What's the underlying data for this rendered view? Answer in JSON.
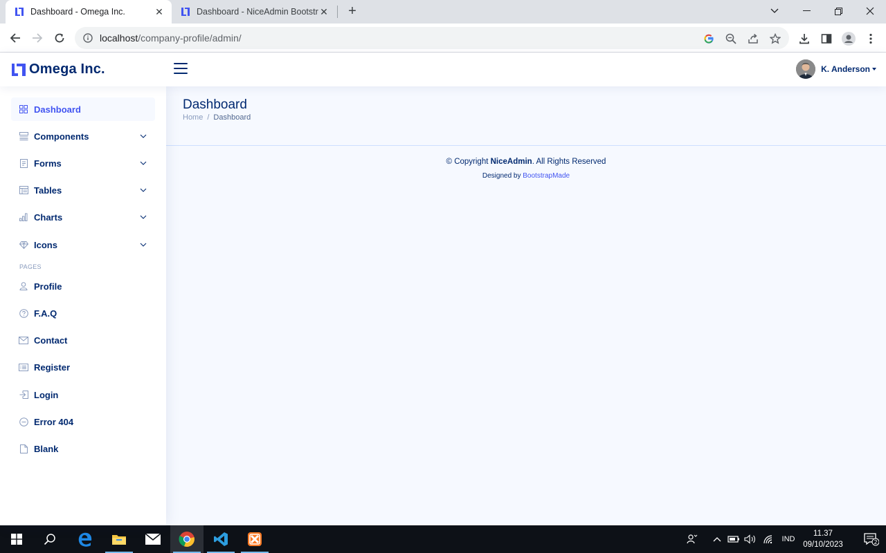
{
  "browser": {
    "tabs": [
      {
        "title": "Dashboard - Omega Inc.",
        "active": true
      },
      {
        "title": "Dashboard - NiceAdmin Bootstr",
        "active": false
      }
    ],
    "url_host": "localhost",
    "url_path": "/company-profile/admin/"
  },
  "header": {
    "logo_text": "Omega Inc.",
    "user_name": "K. Anderson"
  },
  "sidebar": {
    "items": [
      {
        "label": "Dashboard",
        "icon": "grid-icon",
        "active": true,
        "expandable": false
      },
      {
        "label": "Components",
        "icon": "menu-button-icon",
        "active": false,
        "expandable": true
      },
      {
        "label": "Forms",
        "icon": "journal-text-icon",
        "active": false,
        "expandable": true
      },
      {
        "label": "Tables",
        "icon": "layout-text-window-icon",
        "active": false,
        "expandable": true
      },
      {
        "label": "Charts",
        "icon": "bar-chart-icon",
        "active": false,
        "expandable": true
      },
      {
        "label": "Icons",
        "icon": "gem-icon",
        "active": false,
        "expandable": true
      }
    ],
    "pages_heading": "Pages",
    "pages": [
      {
        "label": "Profile",
        "icon": "person-icon"
      },
      {
        "label": "F.A.Q",
        "icon": "question-circle-icon"
      },
      {
        "label": "Contact",
        "icon": "envelope-icon"
      },
      {
        "label": "Register",
        "icon": "card-list-icon"
      },
      {
        "label": "Login",
        "icon": "box-arrow-in-right-icon"
      },
      {
        "label": "Error 404",
        "icon": "dash-circle-icon"
      },
      {
        "label": "Blank",
        "icon": "file-icon"
      }
    ]
  },
  "main": {
    "title": "Dashboard",
    "breadcrumb_home": "Home",
    "breadcrumb_sep": "/",
    "breadcrumb_current": "Dashboard"
  },
  "footer": {
    "copyright_prefix": "© Copyright",
    "copyright_brand": "NiceAdmin",
    "copyright_suffix": ". All Rights Reserved",
    "designed_by": "Designed by",
    "designer": "BootstrapMade"
  },
  "taskbar": {
    "language": "IND",
    "time": "11.37",
    "date": "09/10/2023",
    "notification_count": "2"
  },
  "colors": {
    "brand_dark": "#012970",
    "brand_accent": "#4154f1",
    "main_bg": "#f6f9ff"
  }
}
